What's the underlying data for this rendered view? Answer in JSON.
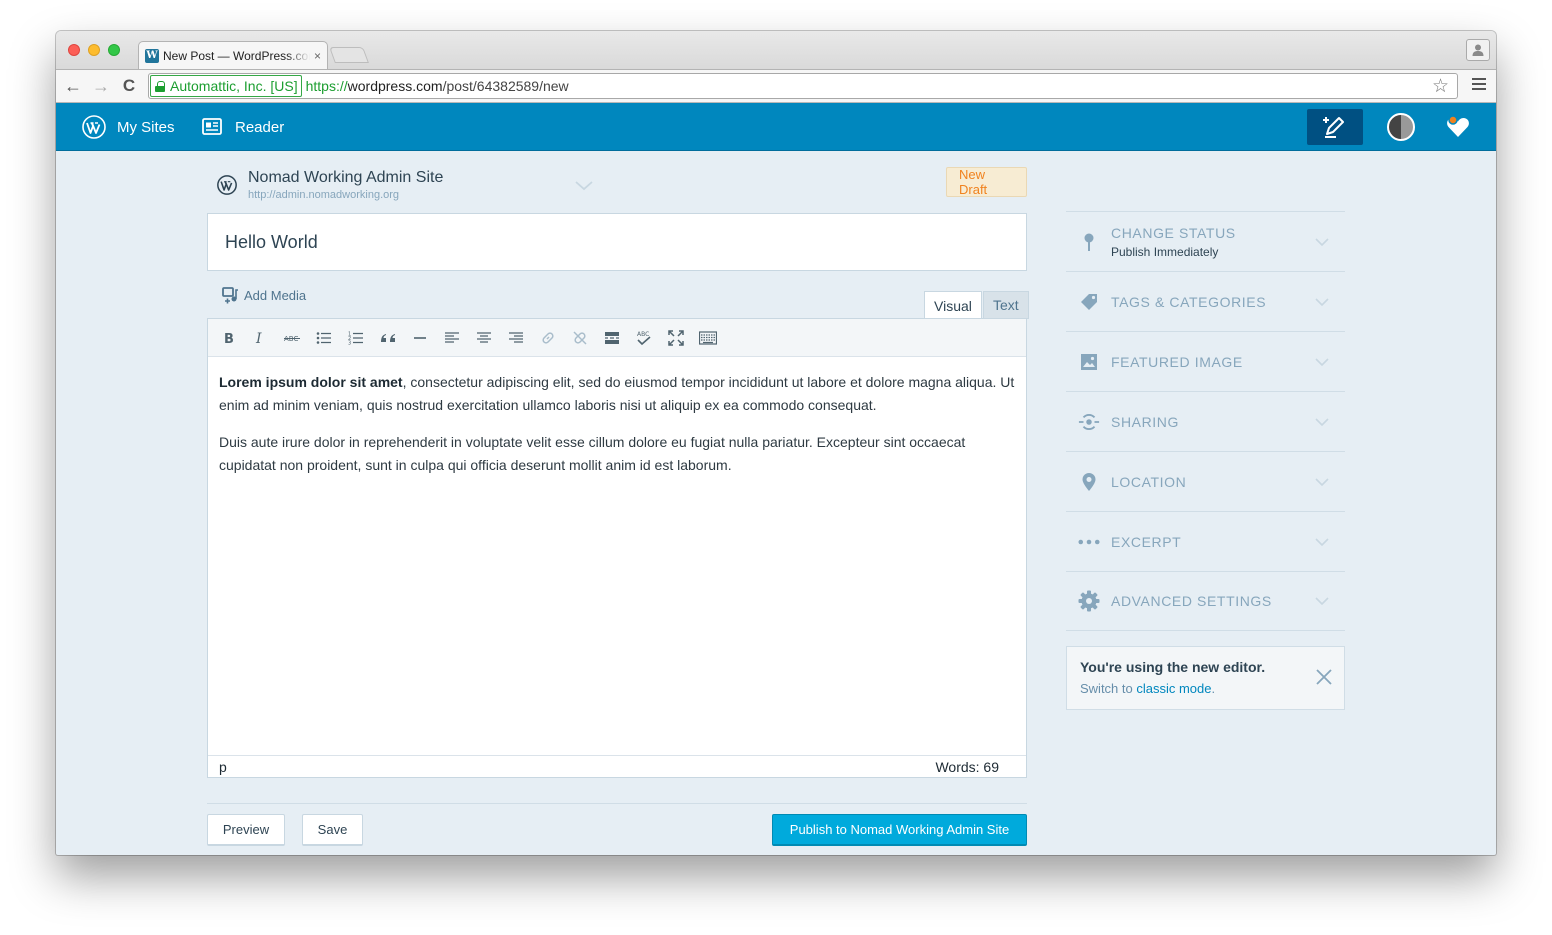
{
  "browser": {
    "tab_title": "New Post — WordPress.com",
    "tab_favicon": "W",
    "tab_close": "×",
    "ev_label": "Automattic, Inc. [US]",
    "url_scheme": "https://",
    "url_host": "wordpress.com",
    "url_path": "/post/64382589/new",
    "back_glyph": "←",
    "forward_glyph": "→",
    "reload_glyph": "C",
    "star_glyph": "☆",
    "icons": [
      "back-icon",
      "forward-icon",
      "reload-icon",
      "lock-icon",
      "star-icon",
      "menu-icon",
      "profile-icon"
    ]
  },
  "masterbar": {
    "my_sites": "My Sites",
    "reader": "Reader",
    "icons": [
      "wordpress-logo-icon",
      "reader-icon",
      "write-post-icon",
      "avatar",
      "notifications-icon"
    ],
    "notification_dot_color": "#f0821e"
  },
  "site": {
    "name": "Nomad Working Admin Site",
    "url": "http://admin.nomadworking.org",
    "status_badge": "New Draft"
  },
  "post": {
    "title": "Hello World",
    "add_media": "Add Media",
    "tabs": {
      "visual": "Visual",
      "text": "Text"
    },
    "paragraphs": [
      {
        "bold": "Lorem ipsum dolor sit amet",
        "rest": ", consectetur adipiscing elit, sed do eiusmod tempor incididunt ut labore et dolore magna aliqua. Ut enim ad minim veniam, quis nostrud exercitation ullamco laboris nisi ut aliquip ex ea commodo consequat."
      },
      {
        "bold": "",
        "rest": "Duis aute irure dolor in reprehenderit in voluptate velit esse cillum dolore eu fugiat nulla pariatur. Excepteur sint occaecat cupidatat non proident, sunt in culpa qui officia deserunt mollit anim id est laborum."
      }
    ],
    "element_path": "p",
    "word_count": "Words: 69",
    "toolbar_buttons": [
      "bold",
      "italic",
      "strikethrough",
      "bullet-list",
      "numbered-list",
      "blockquote",
      "horizontal-rule",
      "align-left",
      "align-center",
      "align-right",
      "insert-link",
      "remove-link",
      "read-more",
      "spellcheck",
      "fullscreen",
      "toolbar-toggle"
    ]
  },
  "actions": {
    "preview": "Preview",
    "save": "Save",
    "publish": "Publish to Nomad Working Admin Site"
  },
  "sidebar": {
    "items": [
      {
        "label": "Change Status",
        "sub": "Publish Immediately",
        "icon": "pin-icon"
      },
      {
        "label": "Tags & Categories",
        "icon": "tag-icon"
      },
      {
        "label": "Featured Image",
        "icon": "image-icon"
      },
      {
        "label": "Sharing",
        "icon": "sharing-icon"
      },
      {
        "label": "Location",
        "icon": "location-icon"
      },
      {
        "label": "Excerpt",
        "icon": "excerpt-icon"
      },
      {
        "label": "Advanced Settings",
        "icon": "cog-icon"
      }
    ]
  },
  "notice": {
    "title": "You're using the new editor.",
    "prefix": "Switch to ",
    "link": "classic mode",
    "suffix": "."
  },
  "colors": {
    "masterbar": "#0087be",
    "publish": "#00aadc",
    "page_bg": "#e6eef4",
    "draft_badge_text": "#f0821e"
  }
}
